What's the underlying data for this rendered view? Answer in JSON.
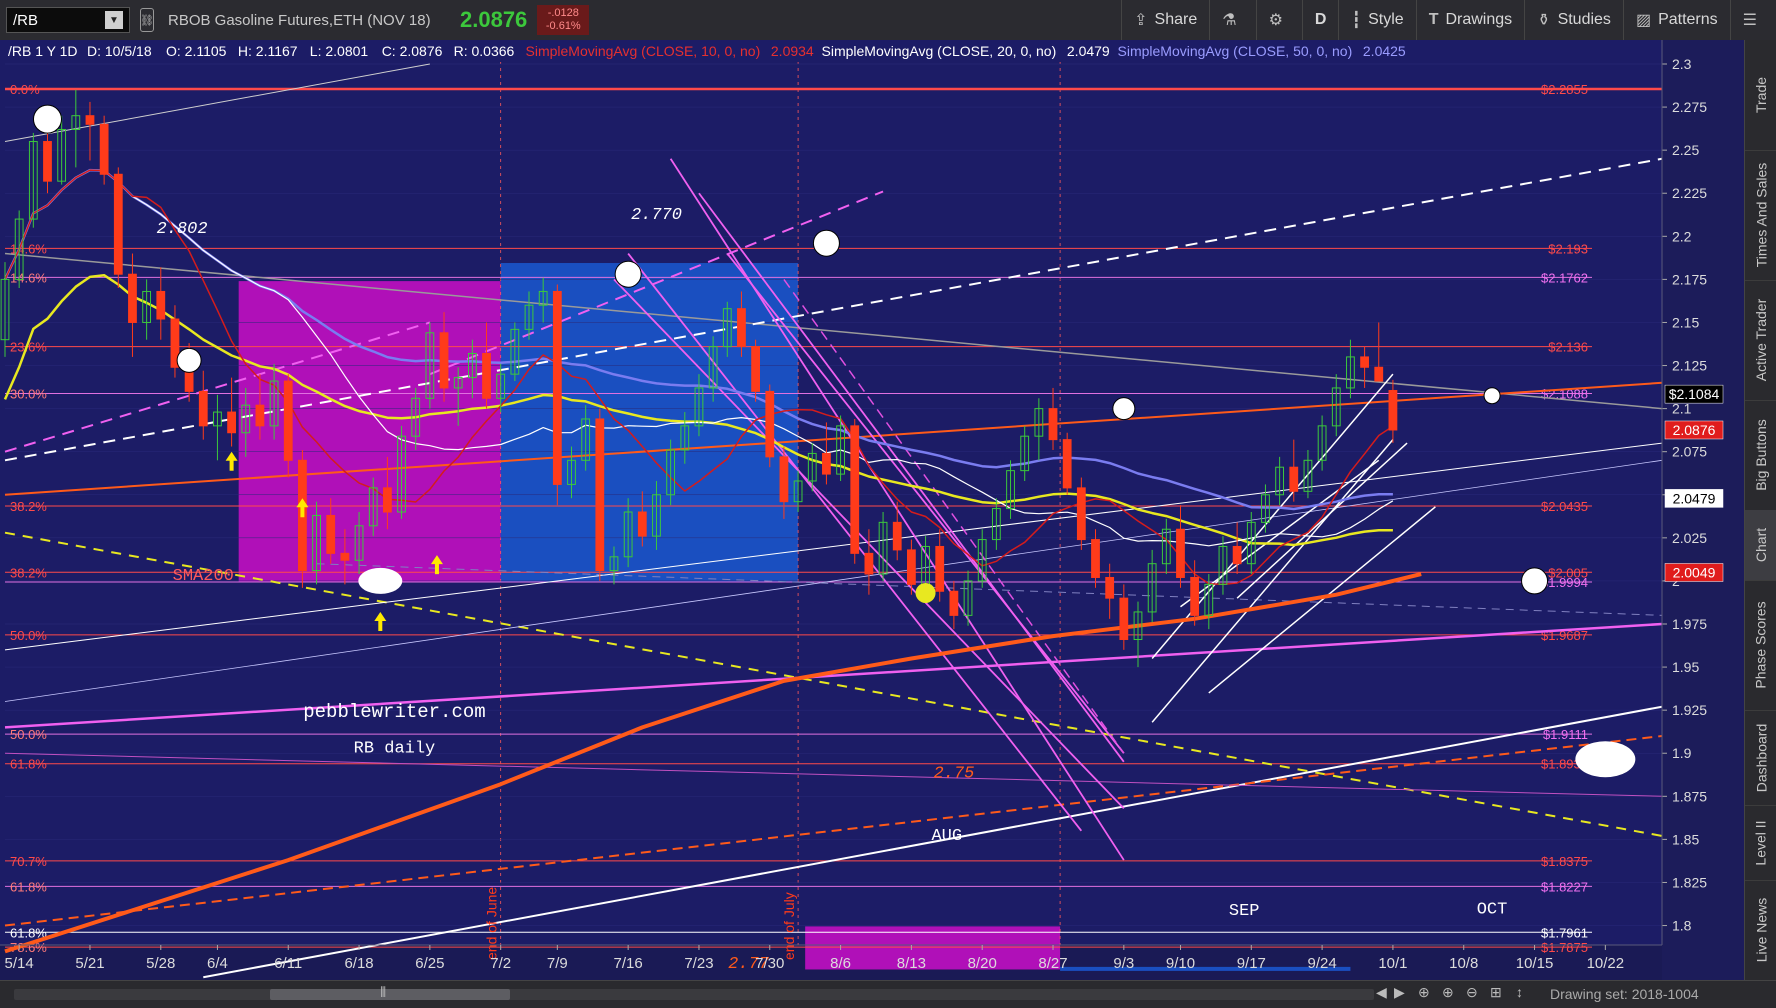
{
  "toolbar": {
    "symbol": "/RB",
    "description": "RBOB Gasoline Futures,ETH (NOV 18)",
    "last": "2.0876",
    "change": "-.0128",
    "change_pct": "-0.61%",
    "buttons": [
      "Share",
      "",
      "",
      "D",
      "Style",
      "Drawings",
      "Studies",
      "Patterns",
      ""
    ]
  },
  "side_tabs": [
    "Trade",
    "Times And Sales",
    "Active Trader",
    "Big Buttons",
    "Chart",
    "Phase Scores",
    "Dashboard",
    "Level II",
    "Live News"
  ],
  "scrollbar": {
    "drawing_set": "Drawing set: 2018-1004"
  },
  "colors": {
    "bg": "#1c1c66",
    "up": "#3cc83c",
    "down": "#ff3b1a",
    "sma10": "#d41c1c",
    "sma20": "#ffffff",
    "sma50": "#7a7cf0",
    "sma200": "#ff5a1a",
    "yellow": "#e8e820",
    "magenta": "#f060f0",
    "blue_box": "#1a4fc0",
    "purple_box": "#b010b8"
  },
  "chart_data": {
    "type": "candlestick",
    "header": {
      "symbol_line": "/RB 1 Y 1D",
      "ohlc": [
        "D: 10/5/18",
        "O: 2.1105",
        "H: 2.1167",
        "L: 2.0801",
        "C: 2.0876",
        "R: 0.0366"
      ],
      "studies": [
        {
          "label": "SimpleMovingAvg (CLOSE, 10, 0, no)",
          "value": "2.0934",
          "color": "#e53030"
        },
        {
          "label": "SimpleMovingAvg (CLOSE, 20, 0, no)",
          "value": "2.0479",
          "color": "#ffffff"
        },
        {
          "label": "SimpleMovingAvg (CLOSE, 50, 0, no)",
          "value": "2.0425",
          "color": "#9a9cff"
        }
      ]
    },
    "x_ticks": [
      {
        "i": 1,
        "t": "5/14"
      },
      {
        "i": 6,
        "t": "5/21"
      },
      {
        "i": 11,
        "t": "5/28"
      },
      {
        "i": 15,
        "t": "6/4"
      },
      {
        "i": 20,
        "t": "6/11"
      },
      {
        "i": 25,
        "t": "6/18"
      },
      {
        "i": 30,
        "t": "6/25"
      },
      {
        "i": 35,
        "t": "7/2"
      },
      {
        "i": 39,
        "t": "7/9"
      },
      {
        "i": 44,
        "t": "7/16"
      },
      {
        "i": 49,
        "t": "7/23"
      },
      {
        "i": 54,
        "t": "7/30"
      },
      {
        "i": 59,
        "t": "8/6"
      },
      {
        "i": 64,
        "t": "8/13"
      },
      {
        "i": 69,
        "t": "8/20"
      },
      {
        "i": 74,
        "t": "8/27"
      },
      {
        "i": 79,
        "t": "9/3"
      },
      {
        "i": 83,
        "t": "9/10"
      },
      {
        "i": 88,
        "t": "9/17"
      },
      {
        "i": 93,
        "t": "9/24"
      },
      {
        "i": 98,
        "t": "10/1"
      },
      {
        "i": 103,
        "t": "10/8"
      },
      {
        "i": 108,
        "t": "10/15"
      },
      {
        "i": 113,
        "t": "10/22"
      }
    ],
    "y_ticks": [
      "2.3",
      "2.275",
      "2.25",
      "2.225",
      "2.2",
      "2.175",
      "2.15",
      "2.125",
      "2.1",
      "2.075",
      "2.05",
      "2.025",
      "2",
      "1.975",
      "1.95",
      "1.925",
      "1.9",
      "1.875",
      "1.85",
      "1.825",
      "1.8"
    ],
    "ylim": [
      1.78,
      2.3
    ],
    "candles": [
      [
        2.14,
        2.185,
        2.13,
        2.175
      ],
      [
        2.175,
        2.215,
        2.17,
        2.21
      ],
      [
        2.21,
        2.26,
        2.205,
        2.255
      ],
      [
        2.255,
        2.268,
        2.225,
        2.232
      ],
      [
        2.232,
        2.27,
        2.23,
        2.262
      ],
      [
        2.262,
        2.285,
        2.24,
        2.27
      ],
      [
        2.27,
        2.278,
        2.244,
        2.265
      ],
      [
        2.265,
        2.27,
        2.23,
        2.236
      ],
      [
        2.236,
        2.24,
        2.17,
        2.178
      ],
      [
        2.178,
        2.19,
        2.13,
        2.15
      ],
      [
        2.15,
        2.175,
        2.14,
        2.168
      ],
      [
        2.168,
        2.182,
        2.14,
        2.152
      ],
      [
        2.152,
        2.16,
        2.118,
        2.124
      ],
      [
        2.124,
        2.138,
        2.104,
        2.11
      ],
      [
        2.11,
        2.122,
        2.082,
        2.09
      ],
      [
        2.09,
        2.108,
        2.07,
        2.098
      ],
      [
        2.098,
        2.118,
        2.078,
        2.086
      ],
      [
        2.086,
        2.112,
        2.072,
        2.102
      ],
      [
        2.102,
        2.12,
        2.082,
        2.09
      ],
      [
        2.09,
        2.126,
        2.082,
        2.116
      ],
      [
        2.116,
        2.12,
        2.06,
        2.07
      ],
      [
        2.07,
        2.076,
        1.996,
        2.006
      ],
      [
        2.006,
        2.046,
        1.998,
        2.038
      ],
      [
        2.038,
        2.048,
        2.01,
        2.016
      ],
      [
        2.016,
        2.03,
        1.998,
        2.012
      ],
      [
        2.012,
        2.04,
        2.004,
        2.032
      ],
      [
        2.032,
        2.06,
        2.026,
        2.054
      ],
      [
        2.054,
        2.072,
        2.03,
        2.04
      ],
      [
        2.04,
        2.09,
        2.036,
        2.084
      ],
      [
        2.084,
        2.112,
        2.076,
        2.106
      ],
      [
        2.106,
        2.15,
        2.1,
        2.144
      ],
      [
        2.144,
        2.156,
        2.104,
        2.112
      ],
      [
        2.112,
        2.124,
        2.09,
        2.118
      ],
      [
        2.118,
        2.14,
        2.106,
        2.132
      ],
      [
        2.132,
        2.15,
        2.1,
        2.106
      ],
      [
        2.106,
        2.126,
        2.098,
        2.12
      ],
      [
        2.12,
        2.15,
        2.116,
        2.146
      ],
      [
        2.146,
        2.168,
        2.14,
        2.16
      ],
      [
        2.16,
        2.176,
        2.15,
        2.168
      ],
      [
        2.168,
        2.172,
        2.044,
        2.056
      ],
      [
        2.056,
        2.078,
        2.048,
        2.07
      ],
      [
        2.07,
        2.102,
        2.064,
        2.094
      ],
      [
        2.094,
        2.1,
        2.0,
        2.006
      ],
      [
        2.006,
        2.02,
        1.998,
        2.014
      ],
      [
        2.014,
        2.048,
        2.008,
        2.04
      ],
      [
        2.04,
        2.052,
        2.02,
        2.026
      ],
      [
        2.026,
        2.058,
        2.018,
        2.05
      ],
      [
        2.05,
        2.082,
        2.044,
        2.076
      ],
      [
        2.076,
        2.098,
        2.068,
        2.09
      ],
      [
        2.09,
        2.12,
        2.084,
        2.112
      ],
      [
        2.112,
        2.142,
        2.104,
        2.136
      ],
      [
        2.136,
        2.162,
        2.13,
        2.158
      ],
      [
        2.158,
        2.168,
        2.13,
        2.136
      ],
      [
        2.136,
        2.14,
        2.104,
        2.11
      ],
      [
        2.11,
        2.114,
        2.066,
        2.072
      ],
      [
        2.072,
        2.078,
        2.036,
        2.046
      ],
      [
        2.046,
        2.064,
        2.04,
        2.058
      ],
      [
        2.058,
        2.08,
        2.052,
        2.074
      ],
      [
        2.074,
        2.092,
        2.056,
        2.062
      ],
      [
        2.062,
        2.096,
        2.058,
        2.09
      ],
      [
        2.09,
        2.094,
        2.01,
        2.016
      ],
      [
        2.016,
        2.03,
        1.992,
        2.004
      ],
      [
        2.004,
        2.04,
        2.0,
        2.034
      ],
      [
        2.034,
        2.046,
        2.012,
        2.018
      ],
      [
        2.018,
        2.024,
        1.992,
        1.998
      ],
      [
        1.998,
        2.026,
        1.99,
        2.02
      ],
      [
        2.02,
        2.03,
        1.988,
        1.994
      ],
      [
        1.994,
        2.0,
        1.972,
        1.98
      ],
      [
        1.98,
        2.006,
        1.974,
        2.0
      ],
      [
        2.0,
        2.03,
        1.996,
        2.024
      ],
      [
        2.024,
        2.048,
        2.018,
        2.042
      ],
      [
        2.042,
        2.07,
        2.036,
        2.064
      ],
      [
        2.064,
        2.09,
        2.058,
        2.084
      ],
      [
        2.084,
        2.106,
        2.07,
        2.1
      ],
      [
        2.1,
        2.112,
        2.076,
        2.082
      ],
      [
        2.082,
        2.086,
        2.05,
        2.054
      ],
      [
        2.054,
        2.06,
        2.018,
        2.024
      ],
      [
        2.024,
        2.03,
        1.996,
        2.002
      ],
      [
        2.002,
        2.01,
        1.978,
        1.99
      ],
      [
        1.99,
        1.998,
        1.96,
        1.966
      ],
      [
        1.966,
        1.988,
        1.95,
        1.982
      ],
      [
        1.982,
        2.018,
        1.976,
        2.01
      ],
      [
        2.01,
        2.036,
        2.004,
        2.03
      ],
      [
        2.03,
        2.044,
        1.996,
        2.002
      ],
      [
        2.002,
        2.012,
        1.974,
        1.98
      ],
      [
        1.98,
        2.004,
        1.972,
        1.998
      ],
      [
        1.998,
        2.026,
        1.992,
        2.02
      ],
      [
        2.02,
        2.034,
        2.004,
        2.01
      ],
      [
        2.01,
        2.04,
        2.004,
        2.034
      ],
      [
        2.034,
        2.056,
        2.028,
        2.05
      ],
      [
        2.05,
        2.072,
        2.044,
        2.066
      ],
      [
        2.066,
        2.082,
        2.046,
        2.052
      ],
      [
        2.052,
        2.076,
        2.048,
        2.07
      ],
      [
        2.07,
        2.096,
        2.064,
        2.09
      ],
      [
        2.09,
        2.12,
        2.084,
        2.112
      ],
      [
        2.112,
        2.14,
        2.106,
        2.13
      ],
      [
        2.13,
        2.136,
        2.112,
        2.124
      ],
      [
        2.124,
        2.15,
        2.118,
        2.116
      ],
      [
        2.1105,
        2.1167,
        2.0801,
        2.0876
      ]
    ],
    "sma200": [
      [
        0,
        1.785
      ],
      [
        20,
        1.838
      ],
      [
        35,
        1.882
      ],
      [
        45,
        1.915
      ],
      [
        55,
        1.942
      ],
      [
        64,
        1.955
      ],
      [
        74,
        1.968
      ],
      [
        84,
        1.978
      ],
      [
        94,
        1.992
      ],
      [
        100,
        2.004
      ]
    ],
    "horizontal_levels": [
      {
        "y": 2.2855,
        "left": "0.0%",
        "right": "$2.2855",
        "rc": "#ff4a4a",
        "lc": "#ff4a4a",
        "lk": "#ff4a4a",
        "w": 2.5
      },
      {
        "y": 2.193,
        "left": "14.6%",
        "right": "$2.193",
        "rc": "#ff4a4a",
        "lc": "#ff4a4a",
        "lk": "#ff4a4a",
        "w": 1
      },
      {
        "y": 2.1762,
        "left": "14.6%",
        "right": "$2.1762",
        "rc": "#f070f0",
        "lc": "#ff7a7a",
        "lk": "#e070e0",
        "w": 1
      },
      {
        "y": 2.136,
        "left": "23.6%",
        "right": "$2.136",
        "rc": "#ff4a4a",
        "lc": "#ff4a4a",
        "lk": "#ff4a4a",
        "w": 1
      },
      {
        "y": 2.1088,
        "left": "30.0%",
        "right": "$2.1088",
        "rc": "#f070f0",
        "lc": "#ff7a7a",
        "lk": "#e070e0",
        "w": 1
      },
      {
        "y": 2.0435,
        "left": "38.2%",
        "right": "$2.0435",
        "rc": "#ff4a4a",
        "lc": "#ff4a4a",
        "lk": "#ff4a4a",
        "w": 1
      },
      {
        "y": 2.005,
        "left": "38.2%",
        "right": "$2.005",
        "rc": "#ff4a4a",
        "lc": "#ff4a4a",
        "lk": "#ff4a4a",
        "w": 1
      },
      {
        "y": 1.9994,
        "left": "",
        "right": "$1.9994",
        "rc": "#f070f0",
        "lc": "#ff7a7a",
        "lk": "#e070e0",
        "w": 1
      },
      {
        "y": 1.9687,
        "left": "50.0%",
        "right": "$1.9687",
        "rc": "#ff4a4a",
        "lc": "#ff4a4a",
        "lk": "#ff4a4a",
        "w": 1
      },
      {
        "y": 1.9111,
        "left": "50.0%",
        "right": "$1.9111",
        "rc": "#f070f0",
        "lc": "#ff7a7a",
        "lk": "#e070e0",
        "w": 1
      },
      {
        "y": 1.8939,
        "left": "61.8%",
        "right": "$1.8939",
        "rc": "#ff4a4a",
        "lc": "#ff4a4a",
        "lk": "#ff4a4a",
        "w": 1
      },
      {
        "y": 1.8375,
        "left": "70.7%",
        "right": "$1.8375",
        "rc": "#ff4a4a",
        "lc": "#ff4a4a",
        "lk": "#ff4a4a",
        "w": 1
      },
      {
        "y": 1.8227,
        "left": "61.8%",
        "right": "$1.8227",
        "rc": "#f070f0",
        "lc": "#ff7a7a",
        "lk": "#e070e0",
        "w": 1
      },
      {
        "y": 1.7961,
        "left": "61.8%",
        "right": "$1.7961",
        "rc": "#ffffff",
        "lc": "#ffffff",
        "lk": "#ffffff",
        "w": 1
      },
      {
        "y": 1.7875,
        "left": "78.6%",
        "right": "$1.7875",
        "rc": "#ff4a4a",
        "lc": "#ff7a7a",
        "lk": "#ff4a4a",
        "w": 1
      }
    ],
    "price_badges": [
      {
        "y": 2.1084,
        "text": "$2.1084",
        "bg": "#000000",
        "fg": "#ffffff"
      },
      {
        "y": 2.0876,
        "text": "2.0876",
        "bg": "#e01c1c",
        "fg": "#ffffff"
      },
      {
        "y": 2.0479,
        "text": "2.0479",
        "bg": "#ffffff",
        "fg": "#000000"
      },
      {
        "y": 2.0049,
        "text": "2.0049",
        "bg": "#e01c1c",
        "fg": "#ffffff"
      }
    ],
    "annotations": [
      {
        "i": 12.5,
        "y": 2.202,
        "text": "2.802",
        "c": "#ffffff"
      },
      {
        "i": 46,
        "y": 2.21,
        "text": "2.770",
        "c": "#ffffff"
      },
      {
        "i": 14,
        "y": 2.0005,
        "text": "SMA200",
        "c": "#ff5a5a"
      },
      {
        "i": 67,
        "y": 1.886,
        "text": "2.75",
        "c": "#ff5a1a"
      },
      {
        "i": 52.5,
        "y": 1.7755,
        "text": "2.77",
        "c": "#ff5a1a"
      },
      {
        "i": 27.5,
        "y": 1.921,
        "text": "pebblewriter.com",
        "c": "#ffffff"
      },
      {
        "i": 27.5,
        "y": 1.9005,
        "text": "RB daily",
        "c": "#ffffff"
      },
      {
        "i": 66.5,
        "y": 1.8495,
        "text": "AUG",
        "c": "#ffffff"
      },
      {
        "i": 87.5,
        "y": 1.806,
        "text": "SEP",
        "c": "#ffffff"
      },
      {
        "i": 105,
        "y": 1.807,
        "text": "OCT",
        "c": "#ffffff"
      }
    ],
    "vertical_labels": [
      {
        "i": 35,
        "text": "end of June"
      },
      {
        "i": 56,
        "text": "end of July"
      }
    ]
  }
}
